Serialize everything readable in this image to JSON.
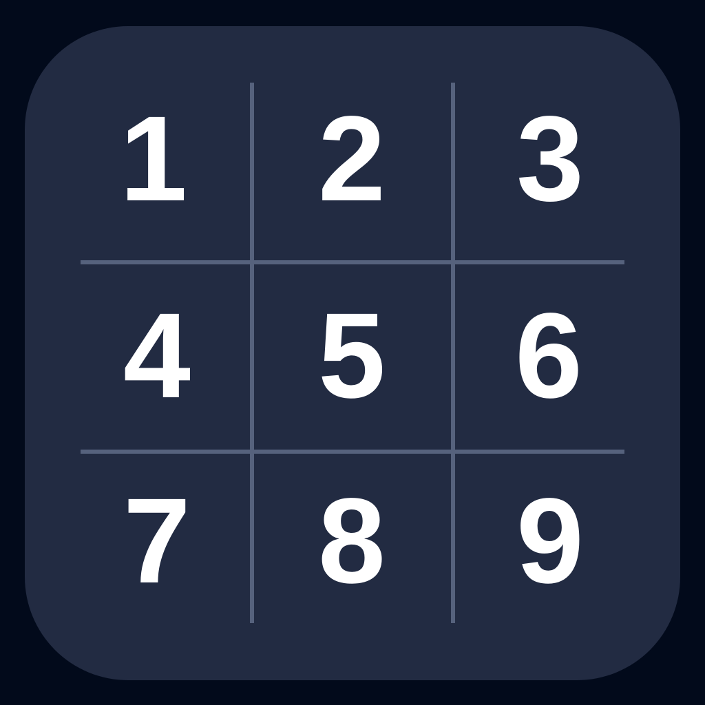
{
  "colors": {
    "background": "#020a1b",
    "card": "#222b42",
    "grid_line": "#56627d",
    "digit": "#ffffff"
  },
  "keypad": {
    "keys": [
      {
        "label": "1"
      },
      {
        "label": "2"
      },
      {
        "label": "3"
      },
      {
        "label": "4"
      },
      {
        "label": "5"
      },
      {
        "label": "6"
      },
      {
        "label": "7"
      },
      {
        "label": "8"
      },
      {
        "label": "9"
      }
    ]
  }
}
